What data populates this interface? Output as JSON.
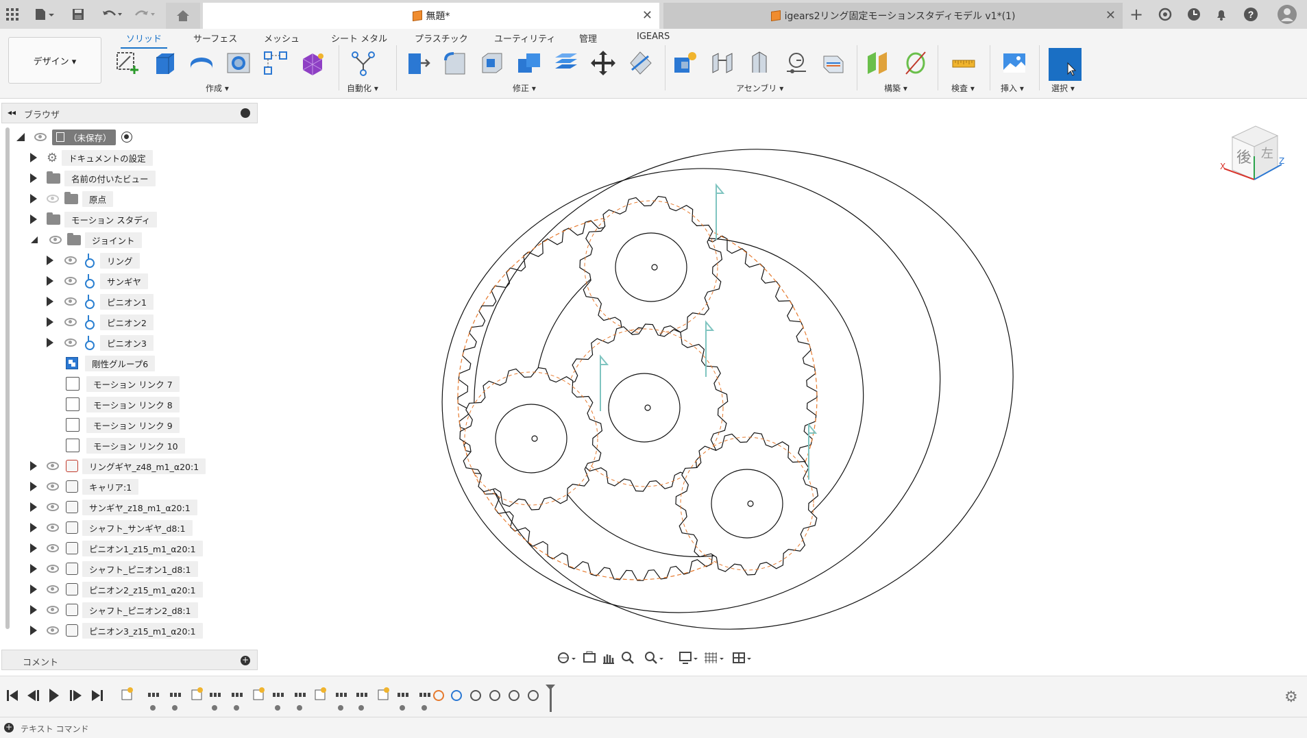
{
  "titlebar": {
    "tab1": "無題*",
    "tab2": "igears2リング固定モーションスタディモデル v1*(1)"
  },
  "ribbon": {
    "tabs": [
      "ソリッド",
      "サーフェス",
      "メッシュ",
      "シート メタル",
      "プラスチック",
      "ユーティリティ",
      "管理",
      "IGEARS"
    ],
    "design": "デザイン ▾",
    "groups": [
      "作成 ▾",
      "自動化 ▾",
      "修正 ▾",
      "アセンブリ ▾",
      "構築 ▾",
      "検査 ▾",
      "挿入 ▾",
      "選択 ▾"
    ]
  },
  "browser": {
    "title": "ブラウザ",
    "root": "（未保存）",
    "items": [
      "ドキュメントの設定",
      "名前の付いたビュー",
      "原点",
      "モーション スタディ",
      "ジョイント",
      "リング",
      "サンギヤ",
      "ピニオン1",
      "ピニオン2",
      "ピニオン3",
      "剛性グループ6",
      "モーション リンク 7",
      "モーション リンク 8",
      "モーション リンク 9",
      "モーション リンク 10",
      "リングギヤ_z48_m1_α20:1",
      "キャリア:1",
      "サンギヤ_z18_m1_α20:1",
      "シャフト_サンギヤ_d8:1",
      "ピニオン1_z15_m1_α20:1",
      "シャフト_ピニオン1_d8:1",
      "ピニオン2_z15_m1_α20:1",
      "シャフト_ピニオン2_d8:1",
      "ピニオン3_z15_m1_α20:1"
    ]
  },
  "viewcube": {
    "face_back": "後",
    "face_left": "左",
    "axis_x": "X",
    "axis_z": "Z"
  },
  "comments": {
    "title": "コメント"
  },
  "textcmd": {
    "label": "テキスト コマンド"
  }
}
